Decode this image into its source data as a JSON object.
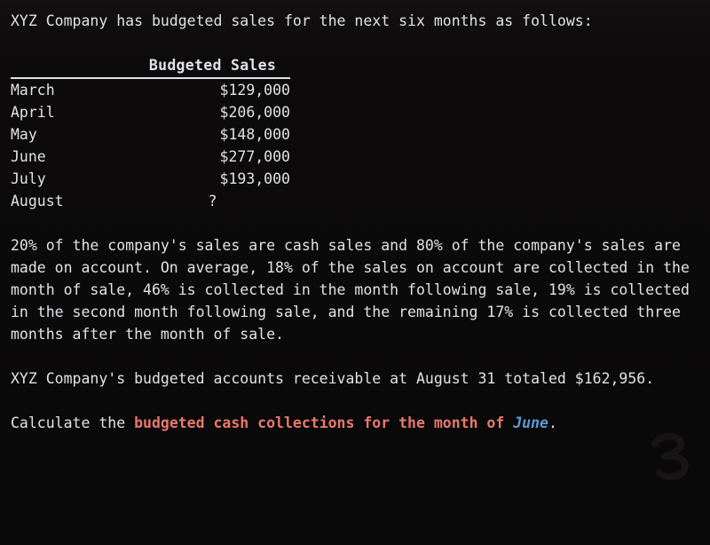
{
  "document": {
    "intro": "XYZ Company has budgeted sales for the next six months as follows:",
    "table": {
      "blank_header": "",
      "amount_header": "Budgeted Sales",
      "rows": [
        {
          "month": "March",
          "amount": "$129,000"
        },
        {
          "month": "April",
          "amount": "$206,000"
        },
        {
          "month": "May",
          "amount": "$148,000"
        },
        {
          "month": "June",
          "amount": "$277,000"
        },
        {
          "month": "July",
          "amount": "$193,000"
        },
        {
          "month": "August",
          "amount": "?"
        }
      ]
    },
    "collection_policy": "20% of the company's sales are cash sales and 80% of the company's sales are made on account. On average, 18% of the sales on account are collected in the month of sale, 46% is collected in the month following sale, 19% is collected in the second month following sale, and the remaining 17% is collected three months after the month of sale.",
    "receivable_note": "XYZ Company's budgeted accounts receivable at August 31 totaled $162,956.",
    "question": {
      "lead": "Calculate the ",
      "emphasis_red": "budgeted cash collections for the month of",
      "emphasis_blue": "June",
      "trailing": "."
    },
    "annotation": {
      "handwritten_number": "3"
    },
    "colors": {
      "background": "#0c0a0a",
      "text": "#dfe3e6",
      "emphasis_red": "#e8786c",
      "emphasis_blue": "#5b9bd5",
      "annotation_ink": "#161314"
    }
  }
}
